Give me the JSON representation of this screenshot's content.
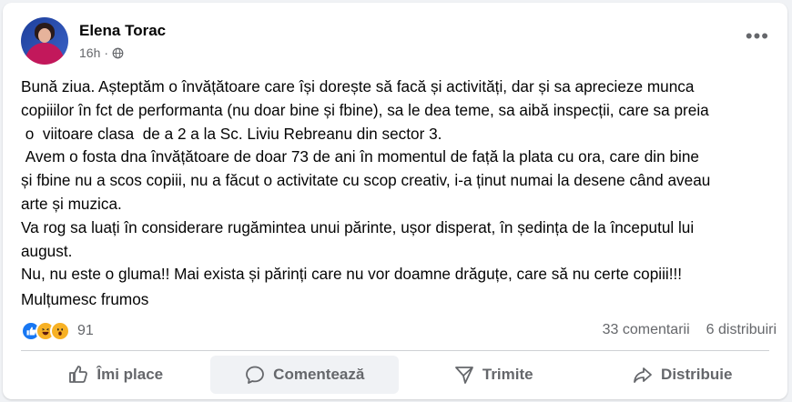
{
  "post": {
    "author": "Elena Torac",
    "time": "16h",
    "separator": "·",
    "more_glyph": "•••",
    "paragraph": "Bună ziua. Așteptăm o învățătoare care își dorește să facă și activități, dar și sa aprecieze munca\ncopiiilor în fct de performanta (nu doar bine și fbine), sa le dea teme, sa aibă inspecții, care sa preia\n o  viitoare clasa  de a 2 a la Sc. Liviu Rebreanu din sector 3.\n Avem o fosta dna învățătoare de doar 73 de ani în momentul de față la plata cu ora, care din bine\nși fbine nu a scos copiii, nu a făcut o activitate cu scop creativ, i-a ținut numai la desene când aveau\narte și muzica.\nVa rog sa luați în considerare rugămintea unui părinte, ușor disperat, în ședința de la începutul lui\naugust.\nNu, nu este o gluma!! Mai exista și părinți care nu vor doamne drăguțe, care să nu certe copiii!!!",
    "thanks": "Mulțumesc frumos"
  },
  "stats": {
    "reaction_count": "91",
    "reaction_icons": [
      "like-icon",
      "haha-icon",
      "wow-icon"
    ],
    "comments": "33 comentarii",
    "shares": "6 distribuiri"
  },
  "actions": {
    "like": "Îmi place",
    "comment": "Comentează",
    "send": "Trimite",
    "share": "Distribuie"
  },
  "colors": {
    "accent": "#1877f2",
    "secondary_text": "#65676b",
    "reaction_yellow": "#f7b125"
  }
}
